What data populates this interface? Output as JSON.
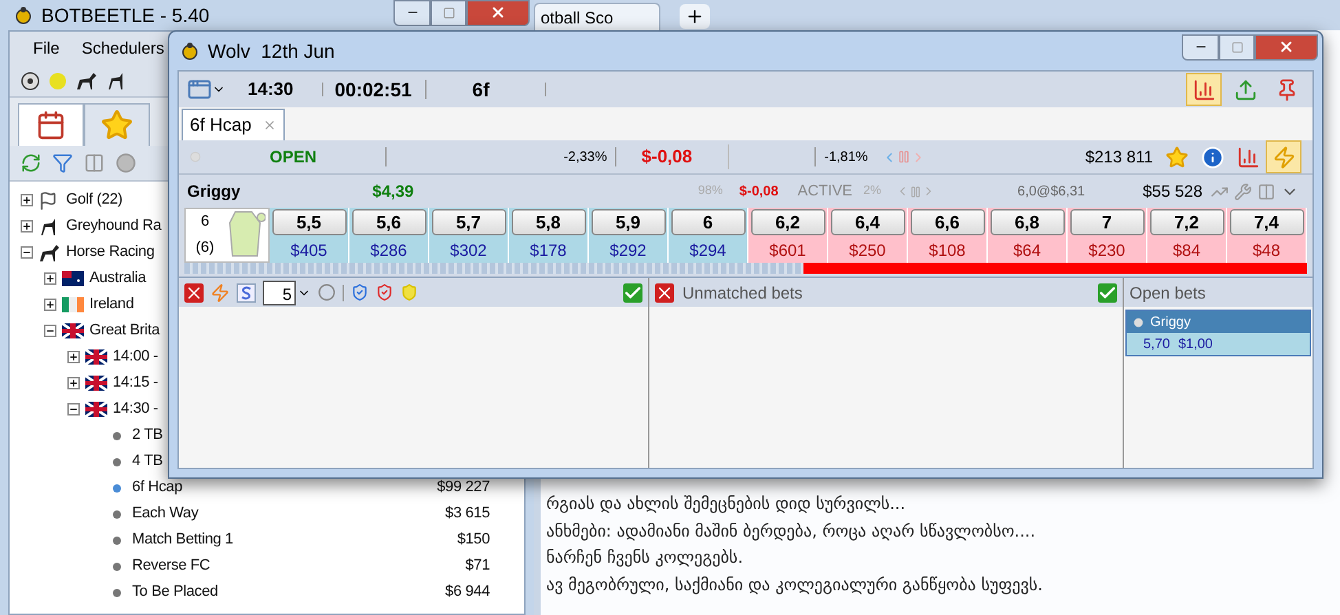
{
  "browser": {
    "tab": "otball Sco"
  },
  "bg_window": {
    "title": "BOTBEETLE - 5.40",
    "menu": [
      "File",
      "Schedulers"
    ],
    "sport_icons": [
      {
        "kind": "soccer"
      },
      {
        "kind": "tennis"
      },
      {
        "kind": "horse"
      },
      {
        "kind": "dog"
      }
    ],
    "nav_tabs": [
      {
        "kind": "calendar",
        "selected": true
      },
      {
        "kind": "star",
        "selected": false
      }
    ],
    "tree": [
      {
        "label": "Golf (22)",
        "kind": "golf",
        "expanded": false
      },
      {
        "label": "Greyhound Ra",
        "kind": "dog",
        "expanded": false
      },
      {
        "label": "Horse Racing",
        "kind": "horse",
        "expanded": true,
        "children": [
          {
            "label": "Australia",
            "kind": "flag-au",
            "expanded": false
          },
          {
            "label": "Ireland",
            "kind": "flag-ie",
            "expanded": false
          },
          {
            "label": "Great Brita",
            "kind": "flag-gb",
            "expanded": true,
            "children": [
              {
                "label": "14:00 -",
                "kind": "flag-gb",
                "expanded": false
              },
              {
                "label": "14:15 -",
                "kind": "flag-gb",
                "expanded": false
              },
              {
                "label": "14:30 -",
                "kind": "flag-gb",
                "expanded": true,
                "children": [
                  {
                    "label": "2 TB",
                    "kind": "market",
                    "selected": false
                  },
                  {
                    "label": "4 TB",
                    "kind": "market",
                    "selected": false
                  },
                  {
                    "label": "6f Hcap",
                    "kind": "market",
                    "selected": true,
                    "amount": "$99 227"
                  },
                  {
                    "label": "Each Way",
                    "kind": "market",
                    "selected": false,
                    "amount": "$3 615"
                  },
                  {
                    "label": "Match Betting 1",
                    "kind": "market",
                    "selected": false,
                    "amount": "$150"
                  },
                  {
                    "label": "Reverse FC",
                    "kind": "market",
                    "selected": false,
                    "amount": "$71"
                  },
                  {
                    "label": "To Be Placed",
                    "kind": "market",
                    "selected": false,
                    "amount": "$6 944"
                  }
                ]
              }
            ]
          }
        ]
      }
    ]
  },
  "notes": [
    "რგიას და ახლის შემეცნების დიდ სურვილს...",
    "ანხმები: ადამიანი მაშინ ბერდება, როცა აღარ სწავლობსო....",
    "ნარჩენ ჩვენს კოლეგებს.",
    "ავ მეგობრული, საქმიანი და კოლეგიალური განწყობა სუფევს."
  ],
  "window": {
    "title": "Wolv  12th Jun",
    "time": "14:30",
    "countdown": "00:02:51",
    "distance": "6f",
    "tools": [
      {
        "kind": "chart",
        "selected": true
      },
      {
        "kind": "upload",
        "selected": false
      },
      {
        "kind": "pin",
        "selected": false
      }
    ],
    "tabs": [
      {
        "label": "6f Hcap",
        "selected": true
      }
    ],
    "market": {
      "status": "OPEN",
      "back_pct": "-2,33%",
      "pl": "$-0,08",
      "lay_pct": "-1,81%",
      "matched": "$213 811",
      "tools": [
        {
          "kind": "star",
          "selected": false
        },
        {
          "kind": "info",
          "selected": false
        },
        {
          "kind": "chart",
          "selected": false
        },
        {
          "kind": "lightning",
          "selected": true
        }
      ]
    },
    "runner": {
      "name": "Griggy",
      "last": "$4,39",
      "pct": "98%",
      "pl": "$-0,08",
      "status": "ACTIVE",
      "pct2": "2%",
      "avg": "6,0@$6,31",
      "matched": "$55 528",
      "number": "6",
      "draw": "(6)"
    },
    "ladder": [
      {
        "kind": "back",
        "price": "5,5",
        "amount": "$405"
      },
      {
        "kind": "back",
        "price": "5,6",
        "amount": "$286"
      },
      {
        "kind": "back",
        "price": "5,7",
        "amount": "$302"
      },
      {
        "kind": "back",
        "price": "5,8",
        "amount": "$178"
      },
      {
        "kind": "back",
        "price": "5,9",
        "amount": "$292"
      },
      {
        "kind": "back",
        "price": "6",
        "amount": "$294"
      },
      {
        "kind": "lay",
        "price": "6,2",
        "amount": "$601"
      },
      {
        "kind": "lay",
        "price": "6,4",
        "amount": "$250"
      },
      {
        "kind": "lay",
        "price": "6,6",
        "amount": "$108"
      },
      {
        "kind": "lay",
        "price": "6,8",
        "amount": "$64"
      },
      {
        "kind": "lay",
        "price": "7",
        "amount": "$230"
      },
      {
        "kind": "lay",
        "price": "7,2",
        "amount": "$84"
      },
      {
        "kind": "lay",
        "price": "7,4",
        "amount": "$48"
      }
    ],
    "stake": "5",
    "unmatched_title": "Unmatched bets",
    "open_title": "Open bets",
    "open_bets": [
      {
        "runner": "Griggy",
        "odds": "5,70",
        "stake": "$1,00",
        "selected": true
      }
    ]
  }
}
